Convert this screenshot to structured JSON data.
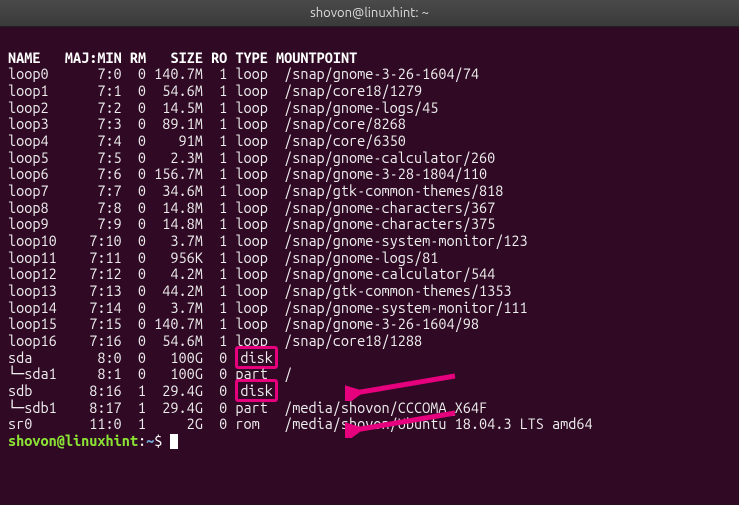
{
  "window": {
    "title": "shovon@linuxhint: ~"
  },
  "columns": [
    "NAME",
    "MAJ:MIN",
    "RM",
    "SIZE",
    "RO",
    "TYPE",
    "MOUNTPOINT"
  ],
  "rows": [
    {
      "name": "loop0",
      "maj": "7:0",
      "rm": "0",
      "size": "140.7M",
      "ro": "1",
      "type": "loop",
      "mount": "/snap/gnome-3-26-1604/74",
      "tree": ""
    },
    {
      "name": "loop1",
      "maj": "7:1",
      "rm": "0",
      "size": "54.6M",
      "ro": "1",
      "type": "loop",
      "mount": "/snap/core18/1279",
      "tree": ""
    },
    {
      "name": "loop2",
      "maj": "7:2",
      "rm": "0",
      "size": "14.5M",
      "ro": "1",
      "type": "loop",
      "mount": "/snap/gnome-logs/45",
      "tree": ""
    },
    {
      "name": "loop3",
      "maj": "7:3",
      "rm": "0",
      "size": "89.1M",
      "ro": "1",
      "type": "loop",
      "mount": "/snap/core/8268",
      "tree": ""
    },
    {
      "name": "loop4",
      "maj": "7:4",
      "rm": "0",
      "size": "91M",
      "ro": "1",
      "type": "loop",
      "mount": "/snap/core/6350",
      "tree": ""
    },
    {
      "name": "loop5",
      "maj": "7:5",
      "rm": "0",
      "size": "2.3M",
      "ro": "1",
      "type": "loop",
      "mount": "/snap/gnome-calculator/260",
      "tree": ""
    },
    {
      "name": "loop6",
      "maj": "7:6",
      "rm": "0",
      "size": "156.7M",
      "ro": "1",
      "type": "loop",
      "mount": "/snap/gnome-3-28-1804/110",
      "tree": ""
    },
    {
      "name": "loop7",
      "maj": "7:7",
      "rm": "0",
      "size": "34.6M",
      "ro": "1",
      "type": "loop",
      "mount": "/snap/gtk-common-themes/818",
      "tree": ""
    },
    {
      "name": "loop8",
      "maj": "7:8",
      "rm": "0",
      "size": "14.8M",
      "ro": "1",
      "type": "loop",
      "mount": "/snap/gnome-characters/367",
      "tree": ""
    },
    {
      "name": "loop9",
      "maj": "7:9",
      "rm": "0",
      "size": "14.8M",
      "ro": "1",
      "type": "loop",
      "mount": "/snap/gnome-characters/375",
      "tree": ""
    },
    {
      "name": "loop10",
      "maj": "7:10",
      "rm": "0",
      "size": "3.7M",
      "ro": "1",
      "type": "loop",
      "mount": "/snap/gnome-system-monitor/123",
      "tree": ""
    },
    {
      "name": "loop11",
      "maj": "7:11",
      "rm": "0",
      "size": "956K",
      "ro": "1",
      "type": "loop",
      "mount": "/snap/gnome-logs/81",
      "tree": ""
    },
    {
      "name": "loop12",
      "maj": "7:12",
      "rm": "0",
      "size": "4.2M",
      "ro": "1",
      "type": "loop",
      "mount": "/snap/gnome-calculator/544",
      "tree": ""
    },
    {
      "name": "loop13",
      "maj": "7:13",
      "rm": "0",
      "size": "44.2M",
      "ro": "1",
      "type": "loop",
      "mount": "/snap/gtk-common-themes/1353",
      "tree": ""
    },
    {
      "name": "loop14",
      "maj": "7:14",
      "rm": "0",
      "size": "3.7M",
      "ro": "1",
      "type": "loop",
      "mount": "/snap/gnome-system-monitor/111",
      "tree": ""
    },
    {
      "name": "loop15",
      "maj": "7:15",
      "rm": "0",
      "size": "140.7M",
      "ro": "1",
      "type": "loop",
      "mount": "/snap/gnome-3-26-1604/98",
      "tree": ""
    },
    {
      "name": "loop16",
      "maj": "7:16",
      "rm": "0",
      "size": "54.6M",
      "ro": "1",
      "type": "loop",
      "mount": "/snap/core18/1288",
      "tree": ""
    },
    {
      "name": "sda",
      "maj": "8:0",
      "rm": "0",
      "size": "100G",
      "ro": "0",
      "type": "disk",
      "mount": "",
      "tree": "",
      "hl": true
    },
    {
      "name": "sda1",
      "maj": "8:1",
      "rm": "0",
      "size": "100G",
      "ro": "0",
      "type": "part",
      "mount": "/",
      "tree": "└─"
    },
    {
      "name": "sdb",
      "maj": "8:16",
      "rm": "1",
      "size": "29.4G",
      "ro": "0",
      "type": "disk",
      "mount": "",
      "tree": "",
      "hl": true
    },
    {
      "name": "sdb1",
      "maj": "8:17",
      "rm": "1",
      "size": "29.4G",
      "ro": "0",
      "type": "part",
      "mount": "/media/shovon/CCCOMA_X64F",
      "tree": "└─"
    },
    {
      "name": "sr0",
      "maj": "11:0",
      "rm": "1",
      "size": "2G",
      "ro": "0",
      "type": "rom",
      "mount": "/media/shovon/Ubuntu 18.04.3 LTS amd64",
      "tree": ""
    }
  ],
  "prompt": {
    "user": "shovon",
    "host": "linuxhint",
    "path": "~",
    "suffix": "$"
  }
}
